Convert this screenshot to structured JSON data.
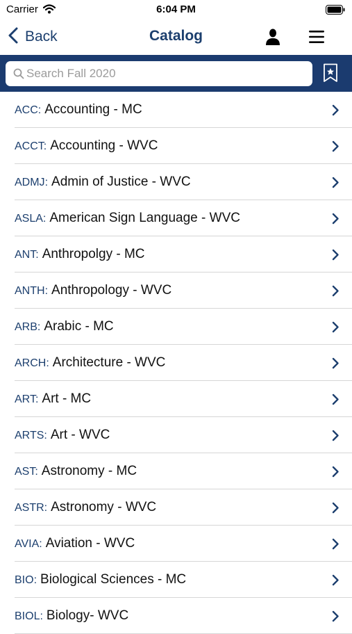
{
  "status_bar": {
    "carrier": "Carrier",
    "time": "6:04 PM"
  },
  "nav": {
    "back_label": "Back",
    "title": "Catalog"
  },
  "icons": {
    "back": "chevron-left-icon",
    "user": "user-icon",
    "menu": "hamburger-menu-icon",
    "search": "search-icon",
    "bookmark": "bookmark-star-icon",
    "row": "chevron-right-icon"
  },
  "colors": {
    "brand": "#1b3b6f",
    "accent_text": "#1c3f6e",
    "divider": "#d6d6d6"
  },
  "search": {
    "placeholder": "Search Fall 2020",
    "value": ""
  },
  "subjects": [
    {
      "code": "ACC",
      "name": "Accounting - MC"
    },
    {
      "code": "ACCT",
      "name": "Accounting - WVC"
    },
    {
      "code": "ADMJ",
      "name": "Admin of Justice - WVC"
    },
    {
      "code": "ASLA",
      "name": "American Sign Language - WVC"
    },
    {
      "code": "ANT",
      "name": "Anthropolgy - MC"
    },
    {
      "code": "ANTH",
      "name": "Anthropology - WVC"
    },
    {
      "code": "ARB",
      "name": "Arabic - MC"
    },
    {
      "code": "ARCH",
      "name": "Architecture - WVC"
    },
    {
      "code": "ART",
      "name": "Art - MC"
    },
    {
      "code": "ARTS",
      "name": "Art - WVC"
    },
    {
      "code": "AST",
      "name": "Astronomy - MC"
    },
    {
      "code": "ASTR",
      "name": "Astronomy - WVC"
    },
    {
      "code": "AVIA",
      "name": "Aviation - WVC"
    },
    {
      "code": "BIO",
      "name": "Biological Sciences - MC"
    },
    {
      "code": "BIOL",
      "name": "Biology- WVC"
    }
  ]
}
